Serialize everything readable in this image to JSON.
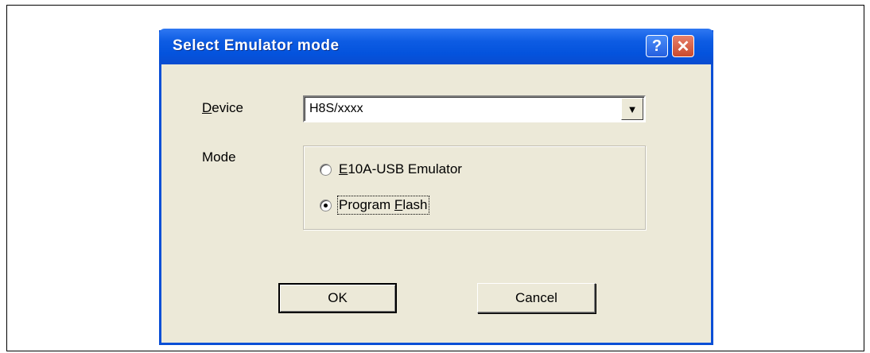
{
  "dialog": {
    "title": "Select Emulator mode",
    "help_glyph": "?",
    "close_glyph": "✕"
  },
  "device": {
    "label_prefix": "",
    "label_accel": "D",
    "label_rest": "evice",
    "value": "H8S/xxxx",
    "dropdown_glyph": "▼"
  },
  "mode": {
    "label": "Mode",
    "options": [
      {
        "accel": "E",
        "rest": "10A-USB Emulator",
        "selected": false
      },
      {
        "accel_pre": "Program ",
        "accel": "F",
        "rest": "lash",
        "selected": true
      }
    ]
  },
  "buttons": {
    "ok": "OK",
    "cancel": "Cancel"
  },
  "colors": {
    "titlebar": "#0a4cd0",
    "dialog_bg": "#ece9d8"
  },
  "icons": [
    "help-icon",
    "close-icon",
    "dropdown-arrow-icon"
  ]
}
